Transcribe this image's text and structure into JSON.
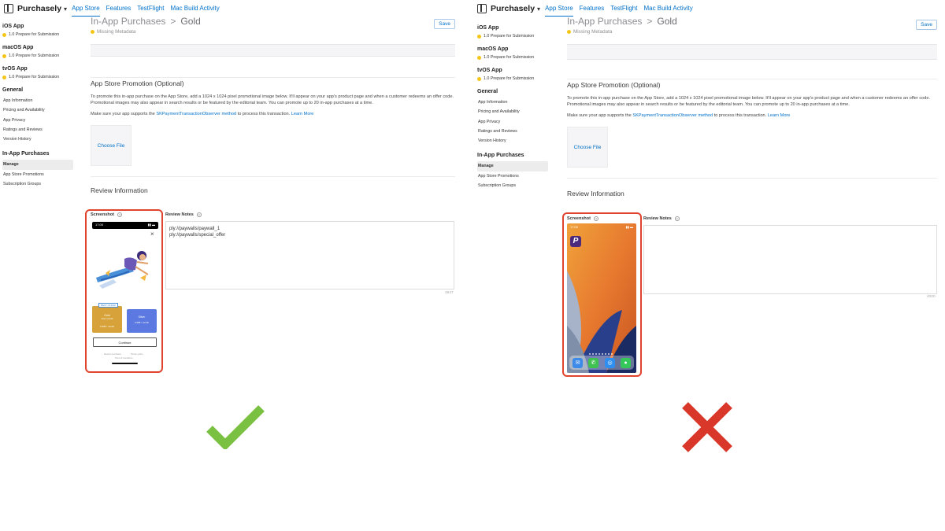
{
  "shared": {
    "app_name": "Purchasely",
    "nav_tabs": [
      "App Store",
      "Features",
      "TestFlight",
      "Mac Build Activity"
    ],
    "sidebar": {
      "ios": {
        "heading": "iOS App",
        "status": "1.0 Prepare for Submission"
      },
      "macos": {
        "heading": "macOS App",
        "status": "1.0 Prepare for Submission"
      },
      "tvos": {
        "heading": "tvOS App",
        "status": "1.0 Prepare for Submission"
      },
      "general_heading": "General",
      "general_items": [
        "App Information",
        "Pricing and Availability",
        "App Privacy",
        "Ratings and Reviews",
        "Version History"
      ],
      "iap_heading": "In-App Purchases",
      "iap_items": [
        "Manage",
        "App Store Promotions",
        "Subscription Groups"
      ]
    },
    "breadcrumb": {
      "parent": "In-App Purchases",
      "separator": ">",
      "current": "Gold"
    },
    "save_label": "Save",
    "status": "Missing Metadata",
    "promo": {
      "title": "App Store Promotion (Optional)",
      "paragraph": "To promote this in-app purchase on the App Store, add a 1024 x 1024 pixel promotional image below. It'll appear on your app's product page and when a customer redeems an offer code. Promotional images may also appear in search results or be featured by the editorial team. You can promote up to 20 in-app purchases at a time.",
      "support_prefix": "Make sure your app supports the",
      "support_link": "SKPaymentTransactionObserver method",
      "support_suffix": "to process this transaction.",
      "learn_more": "Learn More",
      "choose_file": "Choose File"
    },
    "review": {
      "title": "Review Information",
      "screenshot_label": "Screenshot",
      "notes_label": "Review Notes",
      "help": "?"
    }
  },
  "left": {
    "notes_line1": "ply://paywalls/paywall_1",
    "notes_line2": "ply://paywalls/special_offer",
    "counter": "3947",
    "phone": {
      "time": "17:00",
      "close": "×",
      "badge": "BEST OFFER",
      "plan1_title": "Gold",
      "plan1_sub": "One month",
      "plan1_price": "4.99€ / month",
      "plan2_title": "Silver",
      "plan2_price": "2.99€ / month",
      "continue": "Continue",
      "footer_left": "Restore purchases",
      "footer_right": "Privacy policy",
      "footer_bottom": "Terms & Conditions"
    }
  },
  "right": {
    "counter": "4000",
    "phone_time": "17:00"
  },
  "verdicts": {
    "correct": "check-mark",
    "wrong": "cross-mark",
    "check_color": "#7ac142",
    "cross_color": "#d9372a"
  }
}
